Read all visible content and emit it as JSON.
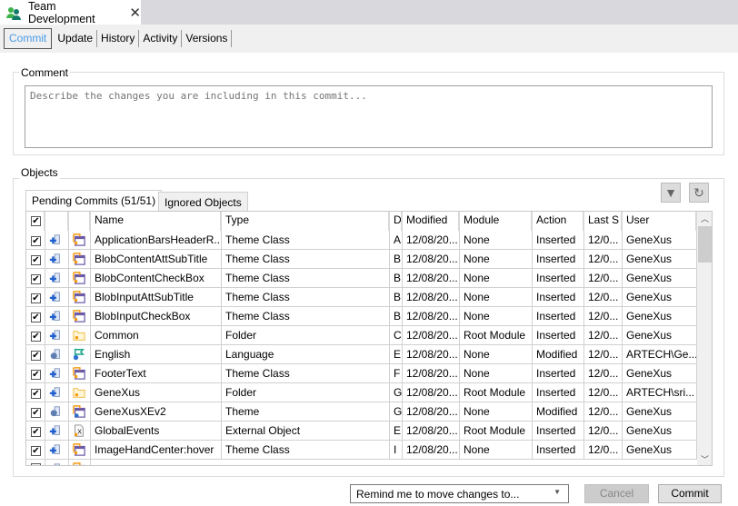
{
  "window": {
    "tab_title": "Team Development",
    "close_icon": "close-icon",
    "tab_icon": "team-users-icon"
  },
  "toolbar": {
    "items": [
      "Commit",
      "Update",
      "History",
      "Activity",
      "Versions"
    ],
    "active": "Commit",
    "active_color": "#4a9be8"
  },
  "comment": {
    "label": "Comment",
    "placeholder": "Describe the changes you are including in this commit..."
  },
  "objects": {
    "label": "Objects",
    "tabs": [
      "Pending Commits (51/51)",
      "Ignored Objects"
    ],
    "filter_icon": "filter-icon",
    "refresh_icon": "refresh-icon",
    "columns": [
      "Name",
      "Type",
      "D",
      "Modified",
      "Module",
      "Action",
      "Last S",
      "User"
    ],
    "rows": [
      {
        "name": "ApplicationBarsHeaderR...",
        "type": "Theme Class",
        "d": "A",
        "modified": "12/08/20...",
        "module": "None",
        "action": "Inserted",
        "last": "12/0...",
        "user": "GeneXus",
        "op": "add",
        "kind": "theme-class"
      },
      {
        "name": "BlobContentAttSubTitle",
        "type": "Theme Class",
        "d": "B",
        "modified": "12/08/20...",
        "module": "None",
        "action": "Inserted",
        "last": "12/0...",
        "user": "GeneXus",
        "op": "add",
        "kind": "theme-class"
      },
      {
        "name": "BlobContentCheckBox",
        "type": "Theme Class",
        "d": "B",
        "modified": "12/08/20...",
        "module": "None",
        "action": "Inserted",
        "last": "12/0...",
        "user": "GeneXus",
        "op": "add",
        "kind": "theme-class"
      },
      {
        "name": "BlobInputAttSubTitle",
        "type": "Theme Class",
        "d": "B",
        "modified": "12/08/20...",
        "module": "None",
        "action": "Inserted",
        "last": "12/0...",
        "user": "GeneXus",
        "op": "add",
        "kind": "theme-class"
      },
      {
        "name": "BlobInputCheckBox",
        "type": "Theme Class",
        "d": "B",
        "modified": "12/08/20...",
        "module": "None",
        "action": "Inserted",
        "last": "12/0...",
        "user": "GeneXus",
        "op": "add",
        "kind": "theme-class"
      },
      {
        "name": "Common",
        "type": "Folder",
        "d": "C",
        "modified": "12/08/20...",
        "module": "Root Module",
        "action": "Inserted",
        "last": "12/0...",
        "user": "GeneXus",
        "op": "add",
        "kind": "folder"
      },
      {
        "name": "English",
        "type": "Language",
        "d": "E",
        "modified": "12/08/20...",
        "module": "None",
        "action": "Modified",
        "last": "12/0...",
        "user": "ARTECH\\Ge...",
        "op": "modify",
        "kind": "language"
      },
      {
        "name": "FooterText",
        "type": "Theme Class",
        "d": "F",
        "modified": "12/08/20...",
        "module": "None",
        "action": "Inserted",
        "last": "12/0...",
        "user": "GeneXus",
        "op": "add",
        "kind": "theme-class"
      },
      {
        "name": "GeneXus",
        "type": "Folder",
        "d": "G",
        "modified": "12/08/20...",
        "module": "Root Module",
        "action": "Inserted",
        "last": "12/0...",
        "user": "ARTECH\\sri...",
        "op": "add",
        "kind": "folder"
      },
      {
        "name": "GeneXusXEv2",
        "type": "Theme",
        "d": "G",
        "modified": "12/08/20...",
        "module": "None",
        "action": "Modified",
        "last": "12/0...",
        "user": "GeneXus",
        "op": "modify",
        "kind": "theme"
      },
      {
        "name": "GlobalEvents",
        "type": "External Object",
        "d": "E",
        "modified": "12/08/20...",
        "module": "Root Module",
        "action": "Inserted",
        "last": "12/0...",
        "user": "GeneXus",
        "op": "add",
        "kind": "external-object"
      },
      {
        "name": "ImageHandCenter:hover",
        "type": "Theme Class",
        "d": "I",
        "modified": "12/08/20...",
        "module": "None",
        "action": "Inserted",
        "last": "12/0...",
        "user": "GeneXus",
        "op": "add",
        "kind": "theme-class"
      }
    ]
  },
  "footer": {
    "remind_select": "Remind me to move changes to...",
    "cancel": "Cancel",
    "commit": "Commit"
  }
}
